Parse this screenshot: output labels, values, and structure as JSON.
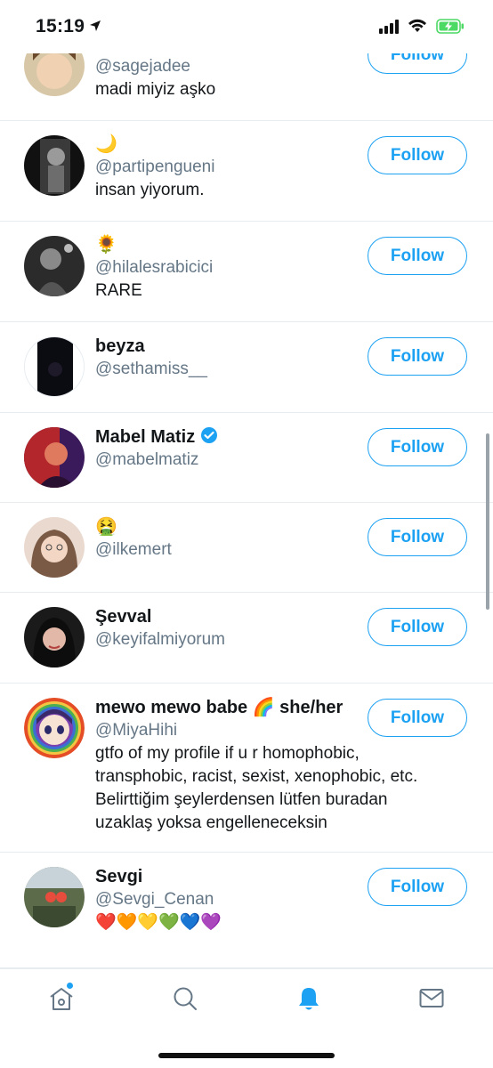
{
  "status_bar": {
    "time": "15:19"
  },
  "rows": [
    {
      "handle": "@sagejadee",
      "bio": "madi miyiz aşko",
      "follow": "Follow"
    },
    {
      "name": "🌙",
      "handle": "@partipengueni",
      "bio": "insan yiyorum.",
      "follow": "Follow"
    },
    {
      "name": "🌻",
      "handle": "@hilalesrabicici",
      "bio": "RARE",
      "follow": "Follow"
    },
    {
      "name": "beyza",
      "handle": "@sethamiss__",
      "follow": "Follow"
    },
    {
      "name": "Mabel Matiz",
      "handle": "@mabelmatiz",
      "follow": "Follow"
    },
    {
      "name": "🤮",
      "handle": "@ilkemert",
      "follow": "Follow"
    },
    {
      "name": "Şevval",
      "handle": "@keyifalmiyorum",
      "follow": "Follow"
    },
    {
      "name": "mewo mewo babe 🌈 she/her",
      "handle": "@MiyaHihi",
      "bio": "gtfo of my profile if u r homophobic, transphobic, racist, sexist, xenophobic, etc. Belirttiğim şeylerdensen lütfen buradan uzaklaş yoksa engelleneceksin",
      "follow": "Follow"
    },
    {
      "name": "Sevgi",
      "handle": "@Sevgi_Cenan",
      "bio": "❤️🧡💛💚💙💜",
      "follow": "Follow"
    }
  ],
  "icons": {
    "home": "home-icon",
    "search": "search-icon",
    "notifications": "bell-icon",
    "messages": "mail-icon",
    "verified": "verified-badge-icon"
  },
  "colors": {
    "accent": "#1da1f2",
    "secondary_text": "#657786",
    "divider": "#e6ecf0"
  }
}
